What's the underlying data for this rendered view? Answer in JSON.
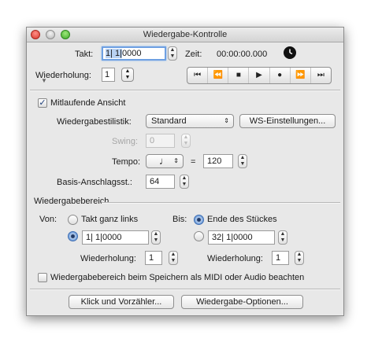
{
  "window": {
    "title": "Wiedergabe-Kontrolle"
  },
  "top": {
    "takt_label": "Takt:",
    "takt_sel": "1| 1|",
    "takt_rest": "0000",
    "zeit_label": "Zeit:",
    "zeit_value": "00:00:00.000",
    "wiederholung_label": "Wiederholung:",
    "wiederholung_value": "1"
  },
  "transport": {
    "buttons": [
      {
        "name": "go-to-start-icon",
        "glyph": "⏮"
      },
      {
        "name": "rewind-icon",
        "glyph": "⏪"
      },
      {
        "name": "stop-icon",
        "glyph": "■"
      },
      {
        "name": "play-icon",
        "glyph": "▶"
      },
      {
        "name": "record-icon",
        "glyph": "●"
      },
      {
        "name": "fast-forward-icon",
        "glyph": "⏩"
      },
      {
        "name": "go-to-end-icon",
        "glyph": "⏭"
      }
    ]
  },
  "view": {
    "mitlaufende_label": "Mitlaufende Ansicht",
    "mitlaufende_checked": true,
    "stilistik_label": "Wiedergabestilistik:",
    "stilistik_value": "Standard",
    "ws_button": "WS-Einstellungen...",
    "swing_label": "Swing:",
    "swing_value": "0",
    "tempo_label": "Tempo:",
    "tempo_equals": "=",
    "tempo_value": "120",
    "basis_label": "Basis-Anschlagsst.:",
    "basis_value": "64"
  },
  "range": {
    "section_label": "Wiedergabebereich",
    "von_label": "Von:",
    "von_option1": "Takt ganz links",
    "von_value": "1| 1|0000",
    "von_wdh_label": "Wiederholung:",
    "von_wdh_value": "1",
    "bis_label": "Bis:",
    "bis_option1": "Ende des Stückes",
    "bis_value": "32| 1|0000",
    "bis_wdh_label": "Wiederholung:",
    "bis_wdh_value": "1",
    "midi_label": "Wiedergabebereich beim Speichern als MIDI oder Audio beachten",
    "midi_checked": false
  },
  "footer": {
    "klick_button": "Klick und Vorzähler...",
    "optionen_button": "Wiedergabe-Optionen..."
  }
}
